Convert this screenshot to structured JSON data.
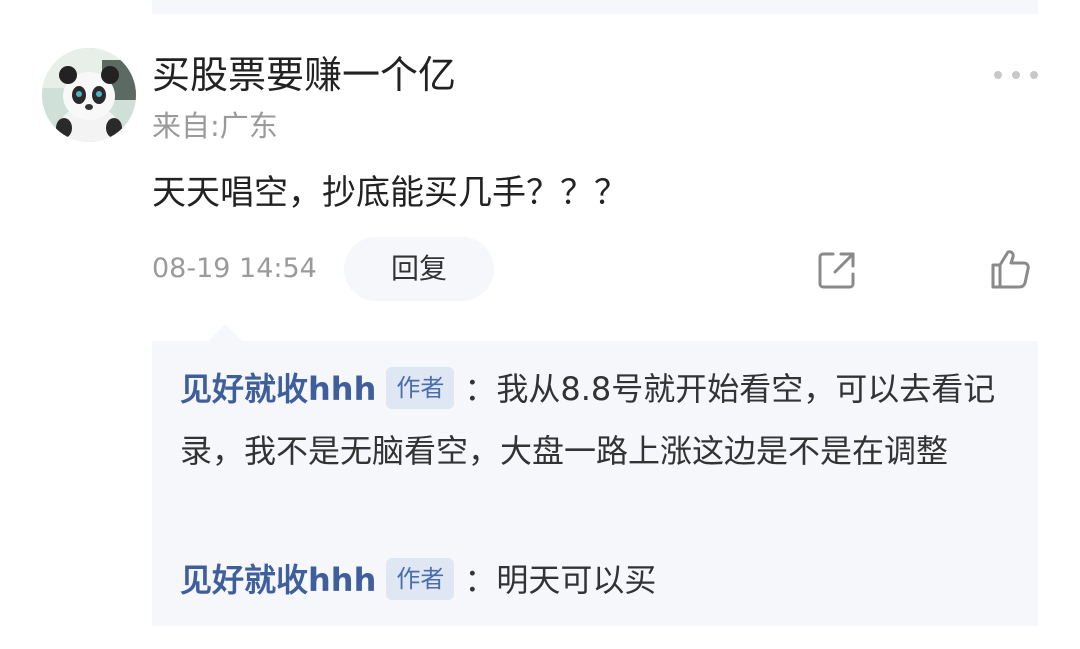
{
  "comment": {
    "username": "买股票要赚一个亿",
    "location": "来自:广东",
    "text": "天天唱空，抄底能买几手？？？",
    "timestamp": "08-19 14:54",
    "reply_label": "回复"
  },
  "icons": {
    "more": "more-icon",
    "share": "share-icon",
    "like": "thumbs-up-icon"
  },
  "thread": {
    "replies": [
      {
        "author": "见好就收hhh",
        "tag": "作者",
        "separator": "：",
        "text": "我从8.8号就开始看空，可以去看记录，我不是无脑看空，大盘一路上涨这边是不是在调整"
      },
      {
        "author": "见好就收hhh",
        "tag": "作者",
        "separator": "：",
        "text": "明天可以买"
      }
    ]
  },
  "colors": {
    "author_link": "#3f5f9c",
    "tag_background": "#dfe6f4",
    "thread_background": "#f5f7fb"
  }
}
